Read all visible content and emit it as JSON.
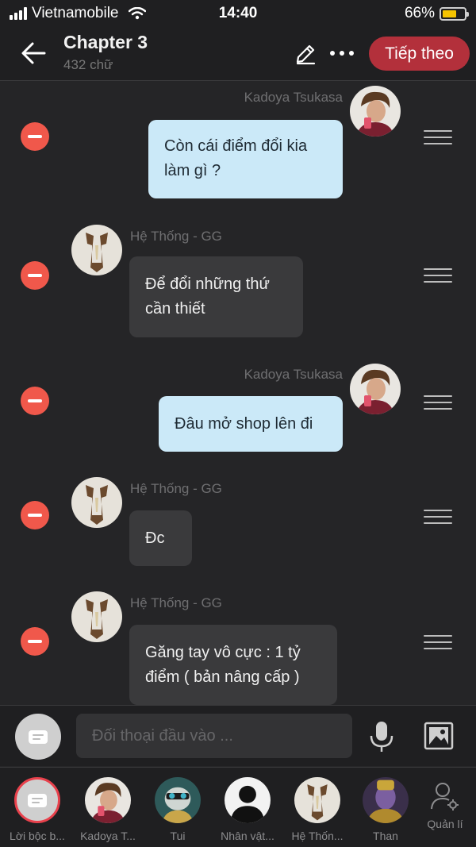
{
  "status_bar": {
    "carrier": "Vietnamobile",
    "time": "14:40",
    "battery": "66%",
    "battery_level": 0.66
  },
  "header": {
    "title": "Chapter 3",
    "subtitle": "432 chữ",
    "next_label": "Tiếp theo"
  },
  "messages": [
    {
      "sender": "Kadoya Tsukasa",
      "side": "right",
      "text": [
        "Còn cái điểm đổi kia",
        "làm gì ?"
      ]
    },
    {
      "sender": "Hệ Thống - GG",
      "side": "left",
      "text": [
        "Để đổi những thứ",
        "cần thiết"
      ]
    },
    {
      "sender": "Kadoya Tsukasa",
      "side": "right",
      "text": [
        "Đâu mở shop lên đi"
      ]
    },
    {
      "sender": "Hệ Thống - GG",
      "side": "left",
      "text": [
        "Đc"
      ]
    },
    {
      "sender": "Hệ Thống - GG",
      "side": "left",
      "text": [
        "Găng tay vô cực : 1 tỷ",
        "điểm ( bản nâng cấp )"
      ]
    }
  ],
  "input": {
    "placeholder": "Đối thoại đầu vào ..."
  },
  "characters": [
    {
      "label": "Lời bộc b...",
      "icon": "narrator-icon"
    },
    {
      "label": "Kadoya T..."
    },
    {
      "label": "Tui"
    },
    {
      "label": "Nhân vật..."
    },
    {
      "label": "Hệ Thốn..."
    },
    {
      "label": "Than"
    }
  ],
  "manage_label": "Quản lí",
  "colors": {
    "accent": "#b3303b",
    "delete": "#f0584b",
    "my_bubble": "#cbe9f8",
    "their_bubble": "#3a3a3c"
  }
}
